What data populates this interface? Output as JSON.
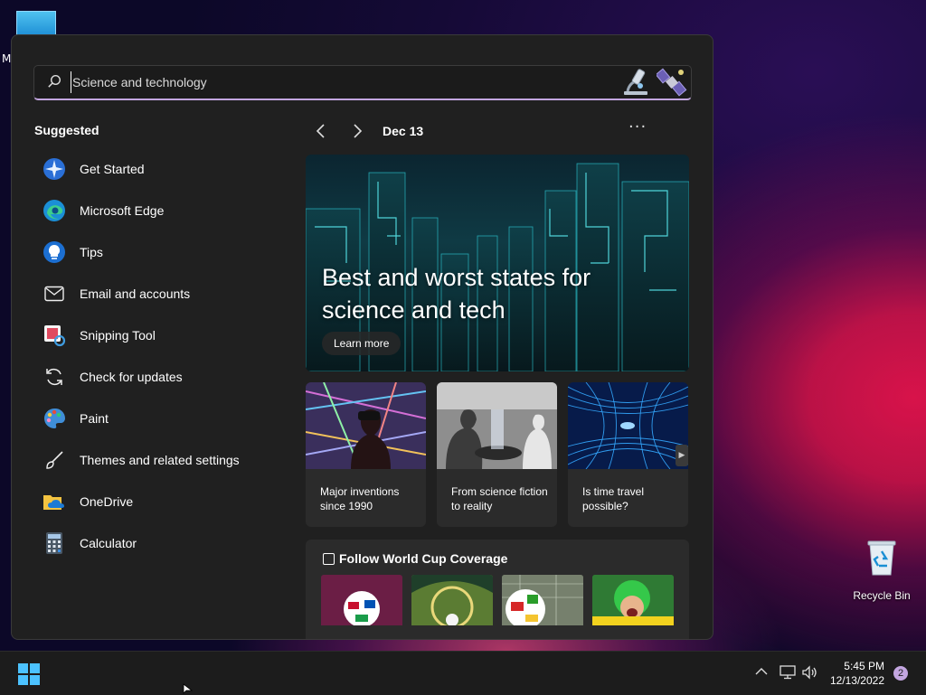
{
  "desktop": {
    "partial_label": "M",
    "recycle_bin_label": "Recycle Bin"
  },
  "start_menu": {
    "search": {
      "value": "Science and technology",
      "placeholder": "Science and technology"
    },
    "suggested": {
      "title": "Suggested",
      "items": [
        {
          "label": "Get Started",
          "icon": "get-started-icon"
        },
        {
          "label": "Microsoft Edge",
          "icon": "edge-icon"
        },
        {
          "label": "Tips",
          "icon": "tips-lightbulb-icon"
        },
        {
          "label": "Email and accounts",
          "icon": "mail-icon"
        },
        {
          "label": "Snipping Tool",
          "icon": "snipping-tool-icon"
        },
        {
          "label": "Check for updates",
          "icon": "refresh-icon"
        },
        {
          "label": "Paint",
          "icon": "paint-palette-icon"
        },
        {
          "label": "Themes and related settings",
          "icon": "brush-icon"
        },
        {
          "label": "OneDrive",
          "icon": "onedrive-folder-icon"
        },
        {
          "label": "Calculator",
          "icon": "calculator-icon"
        }
      ]
    },
    "feed": {
      "date": "Dec 13",
      "more_label": "···",
      "hero": {
        "headline": "Best and worst states for science and tech",
        "button_label": "Learn more"
      },
      "cards": [
        {
          "caption": "Major inventions since 1990"
        },
        {
          "caption": "From science fiction to reality"
        },
        {
          "caption": "Is time travel possible?"
        }
      ],
      "world_cup": {
        "title": "Follow World Cup Coverage"
      }
    }
  },
  "taskbar": {
    "time": "5:45 PM",
    "date": "12/13/2022",
    "notification_count": "2"
  },
  "colors": {
    "accent": "#c3a6e0",
    "menu_bg": "#202020",
    "card_bg": "#2b2b2b"
  }
}
